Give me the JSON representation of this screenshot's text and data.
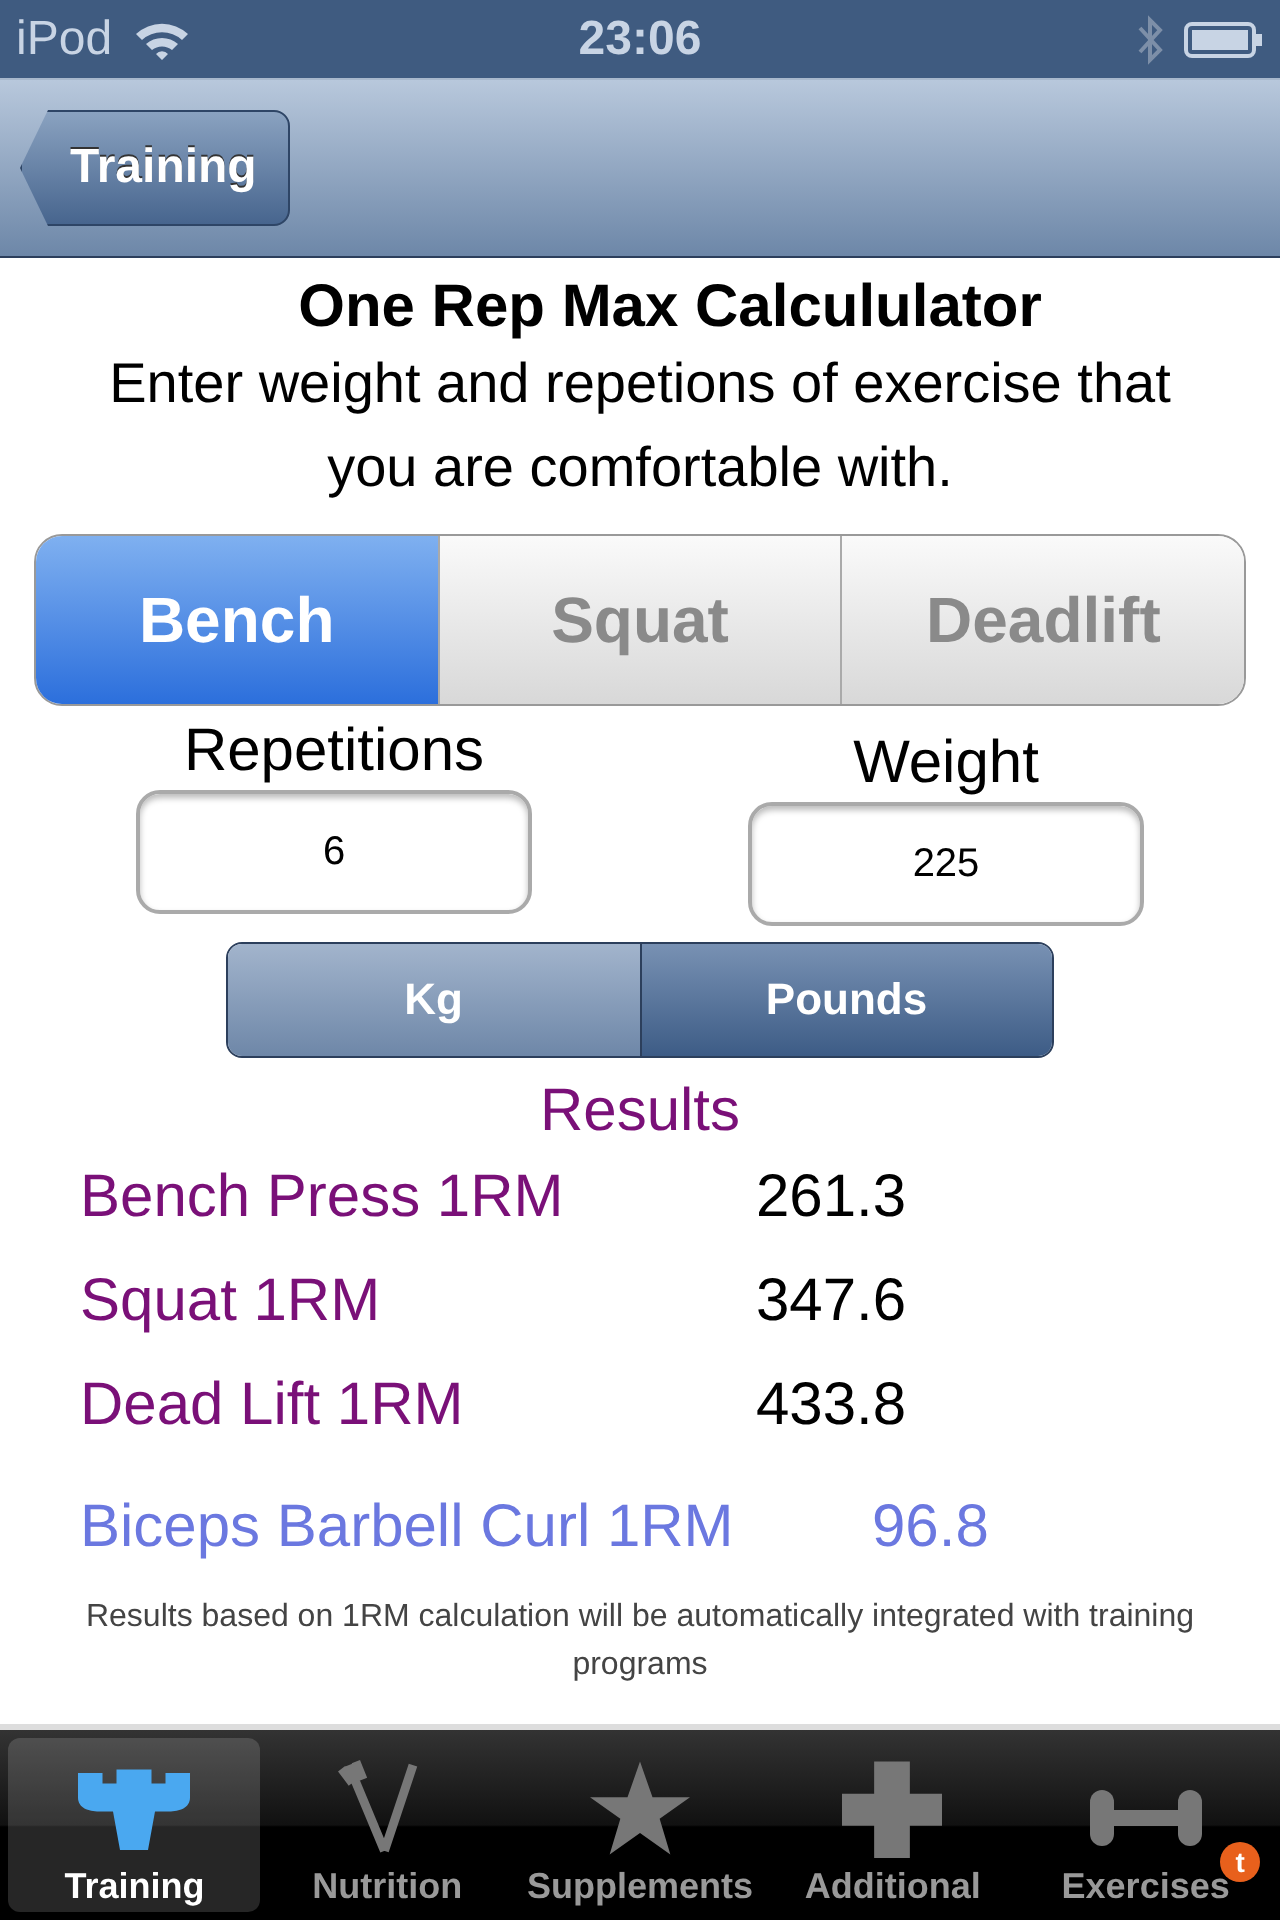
{
  "status_bar": {
    "carrier": "iPod",
    "time": "23:06"
  },
  "nav": {
    "back": "Training"
  },
  "title": "One Rep Max Calcululator",
  "subtitle": "Enter weight and repetions of exercise that you are comfortable with.",
  "exercise_tabs": [
    {
      "label": "Bench",
      "selected": true
    },
    {
      "label": "Squat",
      "selected": false
    },
    {
      "label": "Deadlift",
      "selected": false
    }
  ],
  "fields": [
    {
      "label": "Repetitions",
      "value": "6"
    },
    {
      "label": "Weight",
      "value": "225"
    }
  ],
  "units": [
    {
      "label": "Kg",
      "selected": false
    },
    {
      "label": "Pounds",
      "selected": true
    }
  ],
  "results_title": "Results",
  "results": [
    {
      "name": "Bench Press 1RM",
      "value": "261.3",
      "color": "#7a1078"
    },
    {
      "name": "Squat 1RM",
      "value": "347.6",
      "color": "#7a1078"
    },
    {
      "name": "Dead Lift 1RM",
      "value": "433.8",
      "color": "#7a1078"
    },
    {
      "name": "Biceps Barbell Curl 1RM",
      "value": "96.8",
      "color": "#6b78e0"
    }
  ],
  "note": "Results based on 1RM calculation will be automatically integrated with training programs",
  "tab_bar": [
    {
      "label": "Training",
      "selected": true
    },
    {
      "label": "Nutrition",
      "selected": false
    },
    {
      "label": "Supplements",
      "selected": false
    },
    {
      "label": "Additional",
      "selected": false
    },
    {
      "label": "Exercises",
      "selected": false,
      "badge": "t"
    }
  ]
}
